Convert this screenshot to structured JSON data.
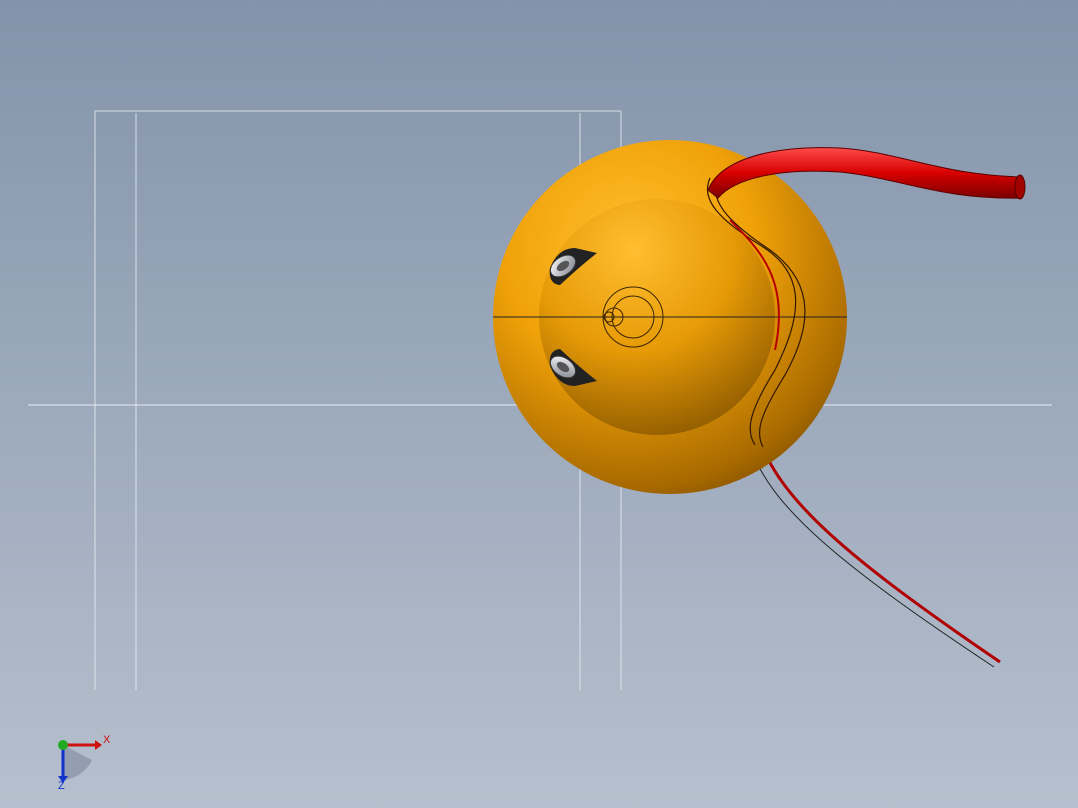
{
  "viewport": {
    "background_top": "#8393a9",
    "background_bottom": "#b6bfcd"
  },
  "model": {
    "sphere_color": "#f2a10a",
    "cable_color": "#cc0000"
  },
  "triad": {
    "x_label": "X",
    "z_label": "Z",
    "x_color": "#cc1111",
    "y_color": "#22aa22",
    "z_color": "#1133cc"
  }
}
